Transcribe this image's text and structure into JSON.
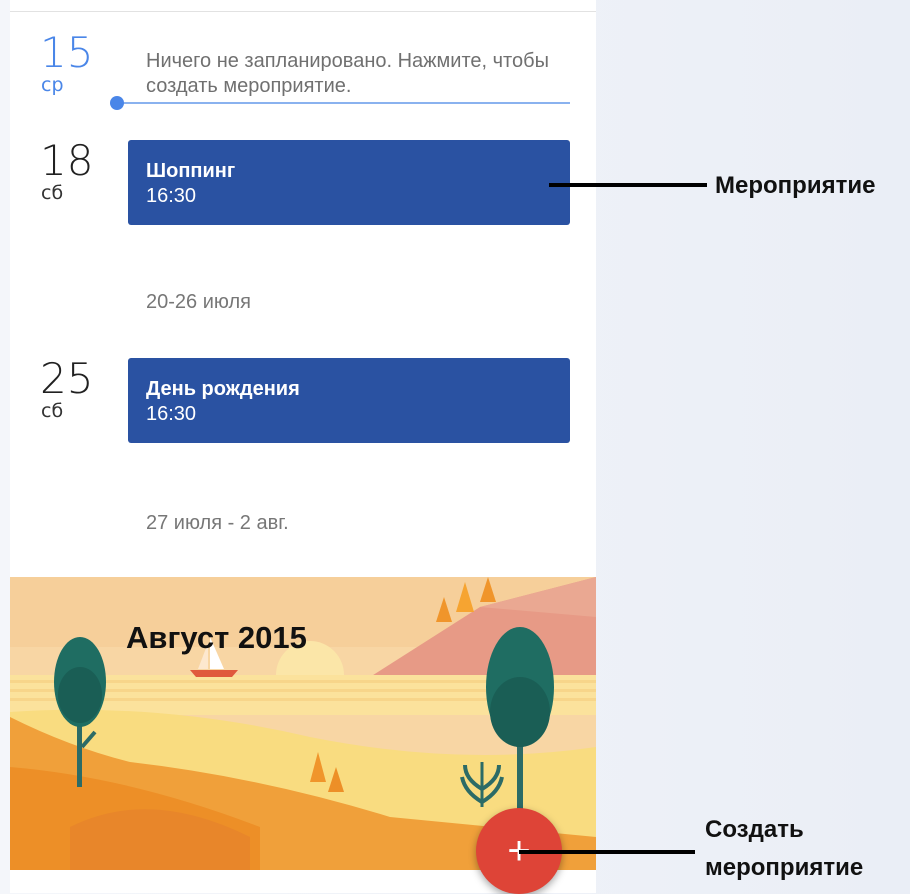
{
  "agenda": {
    "today": {
      "day": "15",
      "weekday": "ср",
      "empty_text": "Ничего не запланировано. Нажмите, чтобы создать мероприятие."
    },
    "day18": {
      "day": "18",
      "weekday": "сб",
      "event": {
        "title": "Шоппинг",
        "time": "16:30"
      }
    },
    "week1": "20-26 июля",
    "day25": {
      "day": "25",
      "weekday": "сб",
      "event": {
        "title": "День рождения",
        "time": "16:30"
      }
    },
    "week2": "27 июля - 2 авг."
  },
  "month_banner": {
    "title": "Август 2015"
  },
  "fab": {
    "label": "+"
  },
  "annotations": {
    "event_label": "Мероприятие",
    "create_label_line1": "Создать",
    "create_label_line2": "мероприятие"
  },
  "colors": {
    "accent": "#4a86e8",
    "event": "#2a52a2",
    "fab": "#de4437"
  }
}
